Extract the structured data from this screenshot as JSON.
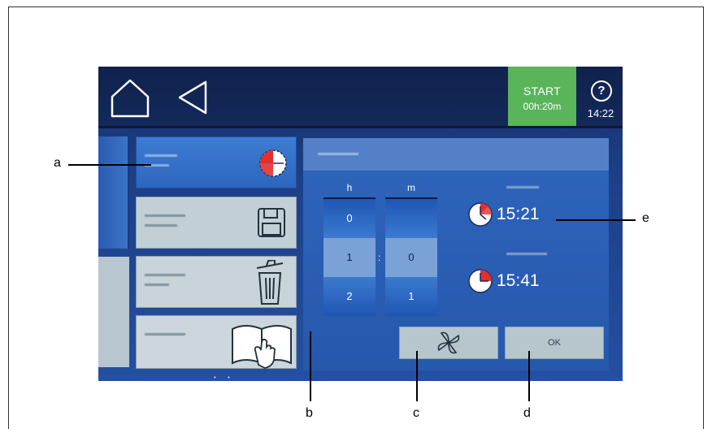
{
  "topbar": {
    "start_label": "START",
    "start_time": "00h:20m",
    "help_glyph": "?",
    "clock": "14:22",
    "start_color": "#5ab45a"
  },
  "spinner": {
    "hours_label": "h",
    "minutes_label": "m",
    "hours": [
      "0",
      "1",
      "2"
    ],
    "minutes": [
      "",
      "0",
      "1"
    ],
    "separator": ":"
  },
  "times": {
    "start_time": "15:21",
    "end_time": "15:41"
  },
  "buttons": {
    "ok_label": "OK"
  },
  "callouts": {
    "a": "a",
    "b": "b",
    "c": "c",
    "d": "d",
    "e": "e"
  },
  "icons": [
    "home-icon",
    "back-icon",
    "timer-icon",
    "save-icon",
    "trash-icon",
    "manual-icon",
    "fan-icon",
    "clock-icon"
  ]
}
